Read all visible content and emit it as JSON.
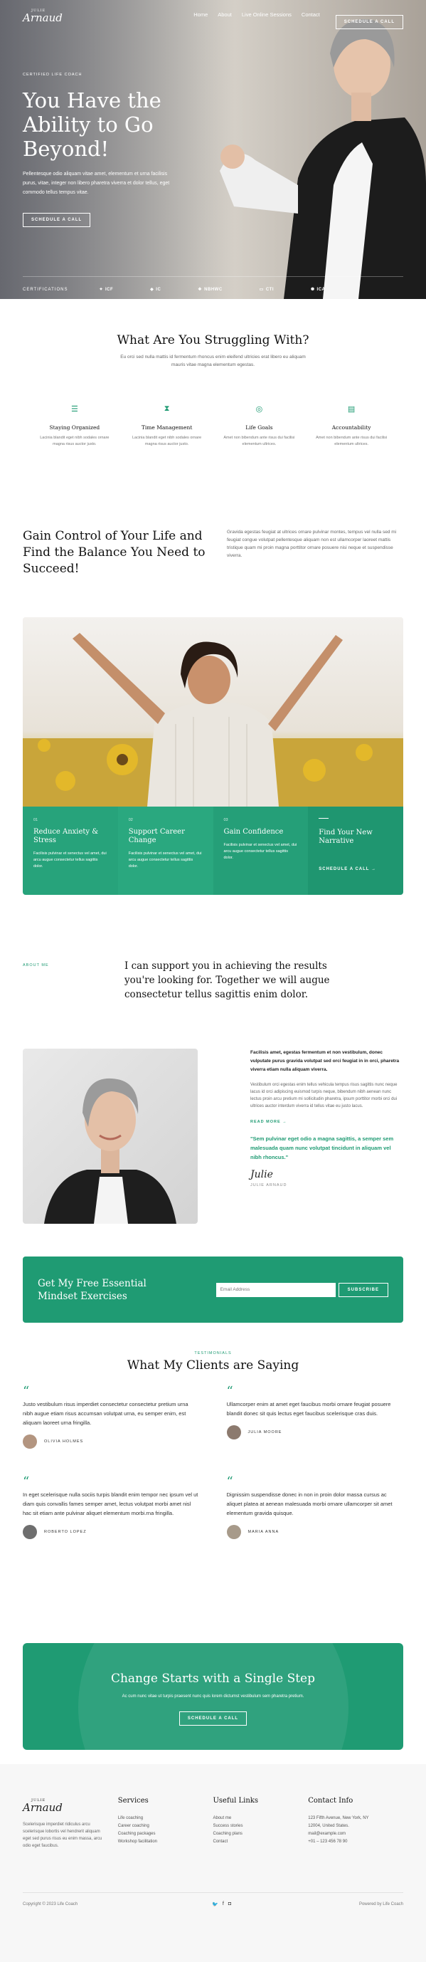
{
  "nav": {
    "logo_small": "JULIE",
    "logo": "Arnaud",
    "links": [
      "Home",
      "About",
      "Live Online Sessions",
      "Contact"
    ],
    "cta": "SCHEDULE A CALL"
  },
  "hero": {
    "eyebrow": "CERTIFIED LIFE COACH",
    "title": "You Have the Ability to Go Beyond!",
    "text": "Pellentesque odio aliquam vitae amet, elementum et urna facilisis purus, vitae, integer non libero pharetra viverra et dolor tellus, eget commodo tellus tempus vitae.",
    "cta": "SCHEDULE A CALL",
    "cert_label": "CERTIFICATIONS",
    "certs": [
      "ICF",
      "IC",
      "NBHWC",
      "CTI",
      "ICA"
    ]
  },
  "struggle": {
    "title": "What Are You Struggling With?",
    "subtitle": "Eu orci sed nulla mattis id fermentum rhoncus enim eleifend ultricies erat libero eu aliquam mauris vitae magna elementum egestas.",
    "items": [
      {
        "icon": "list-icon",
        "title": "Staying Organized",
        "text": "Lacinia blandit eget nibh sodales ornare magna risus auctor justo."
      },
      {
        "icon": "hourglass-icon",
        "title": "Time Management",
        "text": "Lacinia blandit eget nibh sodales ornare magna risus auctor justo."
      },
      {
        "icon": "target-icon",
        "title": "Life Goals",
        "text": "Amet non bibendum ante risus dui facilisi elementum ultrices."
      },
      {
        "icon": "clipboard-icon",
        "title": "Accountability",
        "text": "Amet non bibendum ante risus dui facilisi elementum ultrices."
      }
    ]
  },
  "gain": {
    "title": "Gain Control of Your Life and Find the Balance You Need to Succeed!",
    "text": "Gravida egestas feugiat at ultrices ornare pulvinar montes, tempus vel nulla sed mi feugiat congue volutpat pellentesque aliquam non est ullamcorper laoreet mattis tristique quam mi proin magna porttitor ornare posuere nisi neque et suspendisse viverra."
  },
  "tiles": [
    {
      "num": "01",
      "title": "Reduce Anxiety & Stress",
      "text": "Facilisis pulvinar et senectus vel amet, dui arcu augue consectetur tellus sagittis dolor."
    },
    {
      "num": "02",
      "title": "Support Career Change",
      "text": "Facilisis pulvinar et senectus vel amet, dui arcu augue consectetur tellus sagittis dolor."
    },
    {
      "num": "03",
      "title": "Gain Confidence",
      "text": "Facilisis pulvinar et senectus vel amet, dui arcu augue consectetur tellus sagittis dolor."
    },
    {
      "title": "Find Your New Narrative",
      "cta": "SCHEDULE A CALL"
    }
  ],
  "about": {
    "eyebrow": "ABOUT ME",
    "title": "I can support you in achieving the results you're looking for. Together we will augue consectetur tellus sagittis enim dolor.",
    "bold": "Facilisis amet, egestas fermentum et non vestibulum, donec vulputate purus gravida volutpat sed orci feugiat in in orci, pharetra viverra etiam nulla aliquam viverra.",
    "text": "Vestibulum orci egestas enim tellus vehicula tempus risus sagittis nunc neque lacus id orci adipiscing euismod turpis neque, bibendum nibh aenean nunc lectus proin arcu pretium mi sollicitudin pharetra, ipsum porttitor morbi orci dui ultrices auctor interdum viverra id tellus vitae eu justo lacus.",
    "readmore": "READ MORE",
    "quote": "\"Sem pulvinar eget odio a magna sagittis, a semper sem malesuada quam nunc volutpat tincidunt in aliquam vel nibh rhoncus.\"",
    "signature": "Julie",
    "name": "JULIE ARNAUD"
  },
  "newsletter": {
    "title": "Get My Free Essential Mindset Exercises",
    "placeholder": "Email Address",
    "button": "SUBSCRIBE"
  },
  "testimonials": {
    "eyebrow": "TESTIMONIALS",
    "title": "What My Clients are Saying",
    "items": [
      {
        "text": "Justo vestibulum risus imperdiet consectetur consectetur pretium urna nibh augue etiam risus accumsan volutpat urna, eu semper enim, est aliquam laoreet urna fringilla.",
        "name": "OLIVIA HOLMES"
      },
      {
        "text": "Ullamcorper enim at amet eget faucibus morbi ornare feugiat posuere blandit donec sit quis lectus eget faucibus scelerisque cras duis.",
        "name": "JULIA MOORE"
      },
      {
        "text": "In eget scelerisque nulla sociis turpis blandit enim tempor nec ipsum vel ut diam quis convallis fames semper amet, lectus volutpat morbi amet nisl hac sit etiam ante pulvinar aliquet elementum morbi.rna fringilla.",
        "name": "ROBERTO LOPEZ"
      },
      {
        "text": "Dignissim suspendisse donec in non in proin dolor massa cursus ac aliquet platea at aenean malesuada morbi ornare ullamcorper sit amet elementum gravida quisque.",
        "name": "MARIA ANNA"
      }
    ]
  },
  "cta": {
    "title": "Change Starts with a Single Step",
    "text": "Ac cum nunc vitae ut turpis praesent nunc quis lorem dictumst vestibulum sem pharetra pretium.",
    "button": "SCHEDULE A CALL"
  },
  "footer": {
    "logo_small": "JULIE",
    "logo": "Arnaud",
    "about": "Scelerisque imperdiet ridiculus arcu scelerisque lobortis vel hendrerit aliquam eget sed purus risus eu enim massa, arcu odio eget faucibus.",
    "services_title": "Services",
    "services": [
      "Life coaching",
      "Career coaching",
      "Coaching packages",
      "Workshop facilitation"
    ],
    "links_title": "Useful Links",
    "links": [
      "About me",
      "Success stories",
      "Coaching plans",
      "Contact"
    ],
    "contact_title": "Contact Info",
    "contact": [
      "123 Fifth Avenue, New York, NY",
      "12004, United States.",
      "mail@example.com",
      "+01 – 123 456 78 90"
    ],
    "copyright": "Copyright © 2023 Life Coach",
    "powered": "Powered by Life Coach"
  },
  "colors": {
    "accent": "#1f9b73"
  }
}
